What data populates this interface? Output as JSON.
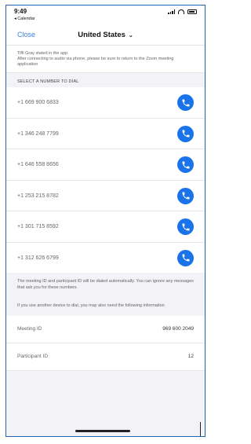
{
  "status": {
    "time": "9:49",
    "back_app": "◂ Calendar"
  },
  "nav": {
    "close_label": "Close",
    "country": "United States",
    "chevron": "chevron-down-icon"
  },
  "notice": {
    "line1": "Tiffi Gray stated in the app",
    "line2": "After connecting to audio via phone, please be sure to return to the Zoom meeting application"
  },
  "section_header": "SELECT A NUMBER TO DIAL",
  "numbers": [
    "+1 669 900 6833",
    "+1 346 248 7799",
    "+1 646 558 8656",
    "+1 253 215 8782",
    "+1 301 715 8592",
    "+1 312 626 6799"
  ],
  "info_text": "The meeting ID and participant ID will be dialed automatically. You can ignore any messages that ask you for these numbers.",
  "info_text2": "If you use another device to dial, you may also need the following information",
  "meeting": {
    "id_label": "Meeting ID",
    "id_value": "969 600 2049",
    "participant_label": "Participant ID",
    "participant_value": "12"
  },
  "colors": {
    "accent": "#1a73e8",
    "link": "#3a86e0",
    "frame_border": "#1f63b5"
  }
}
